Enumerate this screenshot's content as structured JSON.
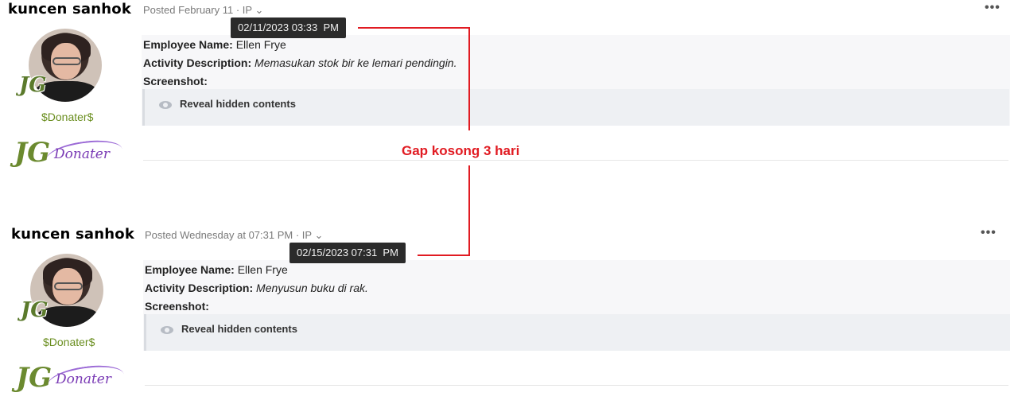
{
  "posts": [
    {
      "author": "kuncen sanhok",
      "avatar_mark": "JG",
      "rank": "$Donater$",
      "badge": {
        "jg": "JG",
        "text": "Donater"
      },
      "meta": "Posted February 11 · IP",
      "tooltip": "02/11/2023 03:33  PM",
      "more_icon": "•••",
      "employee_label": "Employee Name:",
      "employee_value": "Ellen Frye",
      "activity_label": "Activity Description:",
      "activity_value": "Memasukan stok bir ke lemari pendingin.",
      "screenshot_label": "Screenshot:",
      "spoiler_label": "Reveal hidden contents"
    },
    {
      "author": "kuncen sanhok",
      "avatar_mark": "JG",
      "rank": "$Donater$",
      "badge": {
        "jg": "JG",
        "text": "Donater"
      },
      "meta": "Posted Wednesday at 07:31 PM · IP",
      "tooltip": "02/15/2023 07:31  PM",
      "more_icon": "•••",
      "employee_label": "Employee Name:",
      "employee_value": "Ellen Frye",
      "activity_label": "Activity Description:",
      "activity_value": "Menyusun buku di rak.",
      "screenshot_label": "Screenshot:",
      "spoiler_label": "Reveal hidden contents"
    }
  ],
  "annotation": {
    "text": "Gap kosong 3 hari",
    "color": "#e11b22"
  },
  "colors": {
    "rank": "#6a8e1f",
    "tooltip_bg": "#2b2b2b",
    "badge_purple": "#7a3bb5"
  }
}
